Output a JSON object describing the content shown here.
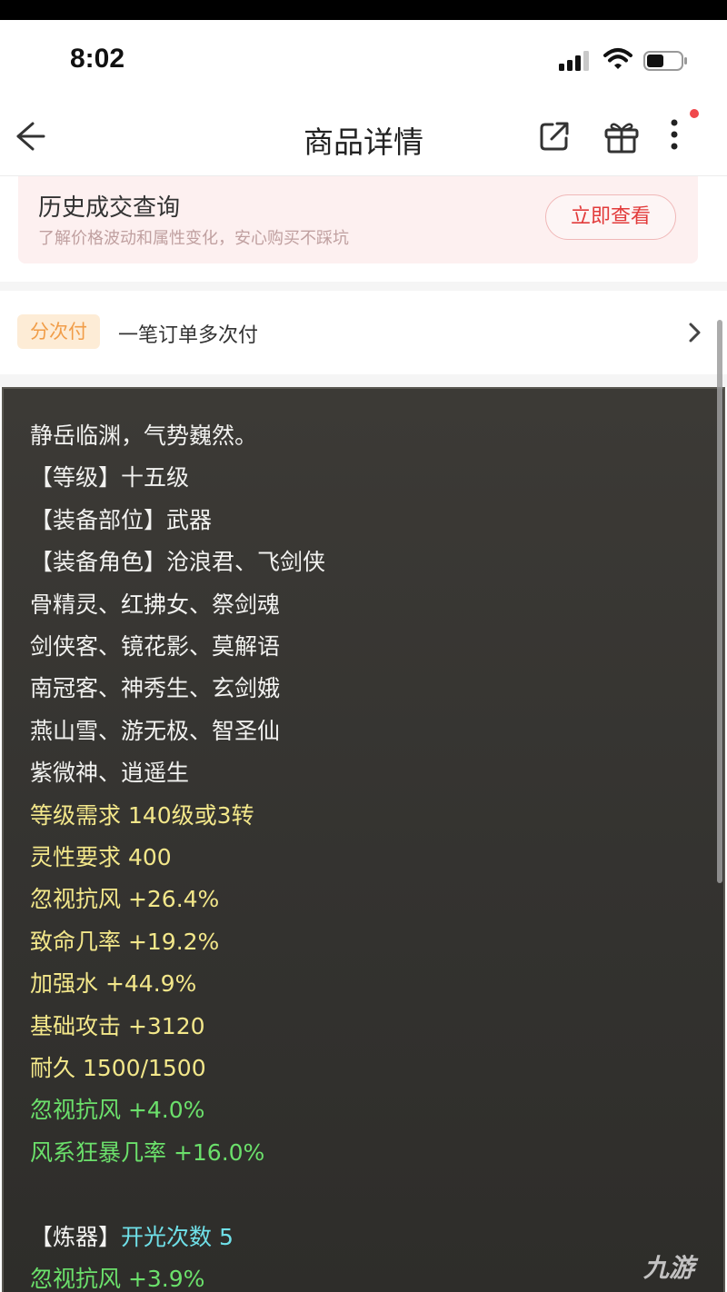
{
  "status_bar": {
    "time": "8:02"
  },
  "nav": {
    "title": "商品详情"
  },
  "history": {
    "title": "历史成交查询",
    "subtitle": "了解价格波动和属性变化，安心购买不踩坑",
    "button": "立即查看"
  },
  "installment": {
    "tag": "分次付",
    "text": "一笔订单多次付"
  },
  "detail": {
    "lines": [
      {
        "text": "静岳临渊，气势巍然。",
        "color": "white"
      },
      {
        "text": "【等级】十五级",
        "color": "white"
      },
      {
        "text": "【装备部位】武器",
        "color": "white"
      },
      {
        "text": "【装备角色】沧浪君、飞剑侠",
        "color": "white"
      },
      {
        "text": "骨精灵、红拂女、祭剑魂",
        "color": "white"
      },
      {
        "text": "剑侠客、镜花影、莫解语",
        "color": "white"
      },
      {
        "text": "南冠客、神秀生、玄剑娥",
        "color": "white"
      },
      {
        "text": "燕山雪、游无极、智圣仙",
        "color": "white"
      },
      {
        "text": "紫微神、逍遥生",
        "color": "white"
      },
      {
        "text": "等级需求 140级或3转",
        "color": "yellow"
      },
      {
        "text": "灵性要求 400",
        "color": "yellow"
      },
      {
        "text": "忽视抗风 +26.4%",
        "color": "yellow"
      },
      {
        "text": "致命几率 +19.2%",
        "color": "yellow"
      },
      {
        "text": "加强水 +44.9%",
        "color": "yellow"
      },
      {
        "text": "基础攻击 +3120",
        "color": "yellow"
      },
      {
        "text": "耐久 1500/1500",
        "color": "yellow"
      },
      {
        "text": "忽视抗风 +4.0%",
        "color": "green"
      },
      {
        "text": "风系狂暴几率 +16.0%",
        "color": "green"
      }
    ],
    "refine_label": "【炼器】",
    "refine_value": "开光次数 5",
    "refine_line": "忽视抗风 +3.9%"
  },
  "watermark": "九游"
}
